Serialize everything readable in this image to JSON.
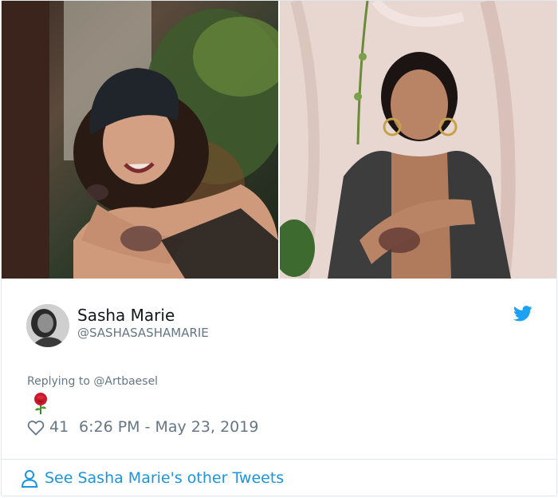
{
  "tweet": {
    "author_name": "Sasha Marie",
    "author_handle": "@SASHASASHAMARIE",
    "reply_context": "Replying to @Artbaesel",
    "body_emoji": "🌹",
    "likes": "41",
    "timestamp": "6:26 PM - May 23, 2019"
  },
  "footer": {
    "link_text": "See Sasha Marie's other Tweets"
  },
  "colors": {
    "twitter_blue": "#1da1f2",
    "link_blue": "#1b95e0",
    "muted_text": "#657786",
    "border": "#e1e8ed"
  },
  "icons": [
    "twitter-bird-icon",
    "heart-icon",
    "person-icon",
    "rose-emoji-icon"
  ]
}
